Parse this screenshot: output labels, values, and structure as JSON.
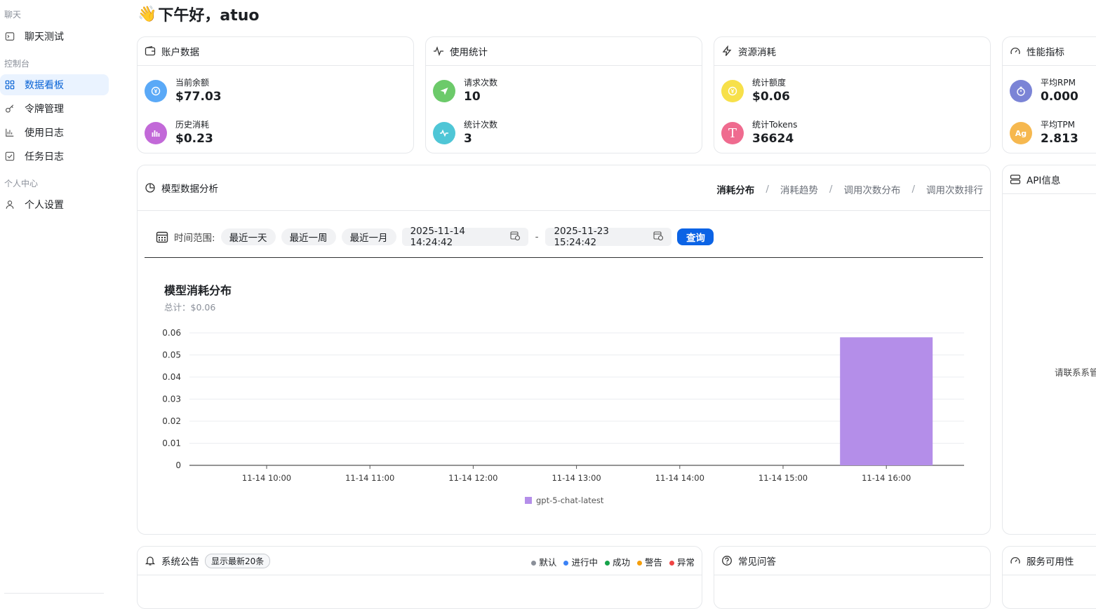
{
  "sidebar": {
    "group_chat": "聊天",
    "chat_test": "聊天测试",
    "group_console": "控制台",
    "dashboard": "数据看板",
    "token_mgmt": "令牌管理",
    "usage_log": "使用日志",
    "task_log": "任务日志",
    "group_personal": "个人中心",
    "personal_settings": "个人设置"
  },
  "greeting": {
    "emoji": "👋",
    "text": "下午好，atuo"
  },
  "account_card": {
    "title": "账户数据",
    "balance_label": "当前余额",
    "balance_value": "$77.03",
    "history_label": "历史消耗",
    "history_value": "$0.23"
  },
  "usage_card": {
    "title": "使用统计",
    "requests_label": "请求次数",
    "requests_value": "10",
    "stats_label": "统计次数",
    "stats_value": "3"
  },
  "resource_card": {
    "title": "资源消耗",
    "quota_label": "统计额度",
    "quota_value": "$0.06",
    "tokens_label": "统计Tokens",
    "tokens_value": "36624",
    "tokens_avatar": "T"
  },
  "perf_card": {
    "title": "性能指标",
    "rpm_label": "平均RPM",
    "rpm_value": "0.000",
    "tpm_label": "平均TPM",
    "tpm_value": "2.813",
    "tpm_avatar": "Ag"
  },
  "analysis": {
    "title": "模型数据分析",
    "tabs": [
      "消耗分布",
      "消耗趋势",
      "调用次数分布",
      "调用次数排行"
    ],
    "tab_sep": "/",
    "time_range_label": "时间范围:",
    "presets": [
      "最近一天",
      "最近一周",
      "最近一月"
    ],
    "start": "2025-11-14 14:24:42",
    "end": "2025-11-23 15:24:42",
    "range_sep": "-",
    "query": "查询"
  },
  "chart_data": {
    "type": "bar",
    "title": "模型消耗分布",
    "subtitle": "总计：$0.06",
    "categories": [
      "11-14 10:00",
      "11-14 11:00",
      "11-14 12:00",
      "11-14 13:00",
      "11-14 14:00",
      "11-14 15:00",
      "11-14 16:00"
    ],
    "series": [
      {
        "name": "gpt-5-chat-latest",
        "values": [
          0,
          0,
          0,
          0,
          0,
          0,
          0.058
        ],
        "color": "#b48ee9"
      }
    ],
    "yticks": [
      "0",
      "0.01",
      "0.02",
      "0.03",
      "0.04",
      "0.05",
      "0.06"
    ],
    "ylim": [
      0,
      0.06
    ],
    "grid": true,
    "legend": "bottom"
  },
  "api_card": {
    "title": "API信息",
    "empty_text": "请联系系管理"
  },
  "notice_card": {
    "title": "系统公告",
    "badge": "显示最新20条",
    "legend": [
      {
        "label": "默认",
        "color": "#8a8f99"
      },
      {
        "label": "进行中",
        "color": "#3b82f6"
      },
      {
        "label": "成功",
        "color": "#16a34a"
      },
      {
        "label": "警告",
        "color": "#f59e0b"
      },
      {
        "label": "异常",
        "color": "#ef4444"
      }
    ]
  },
  "faq_card": {
    "title": "常见问答"
  },
  "service_card": {
    "title": "服务可用性"
  },
  "colors": {
    "accent": "#0b63e5",
    "balance_icon": "#5aa9f7",
    "history_icon": "#c269d8",
    "requests_icon": "#6cca6a",
    "stats_icon": "#4fc6d6",
    "quota_icon": "#f7e04a",
    "tokens_icon": "#ef6b8f",
    "rpm_icon": "#7b84d6",
    "tpm_icon": "#f6b84f"
  }
}
